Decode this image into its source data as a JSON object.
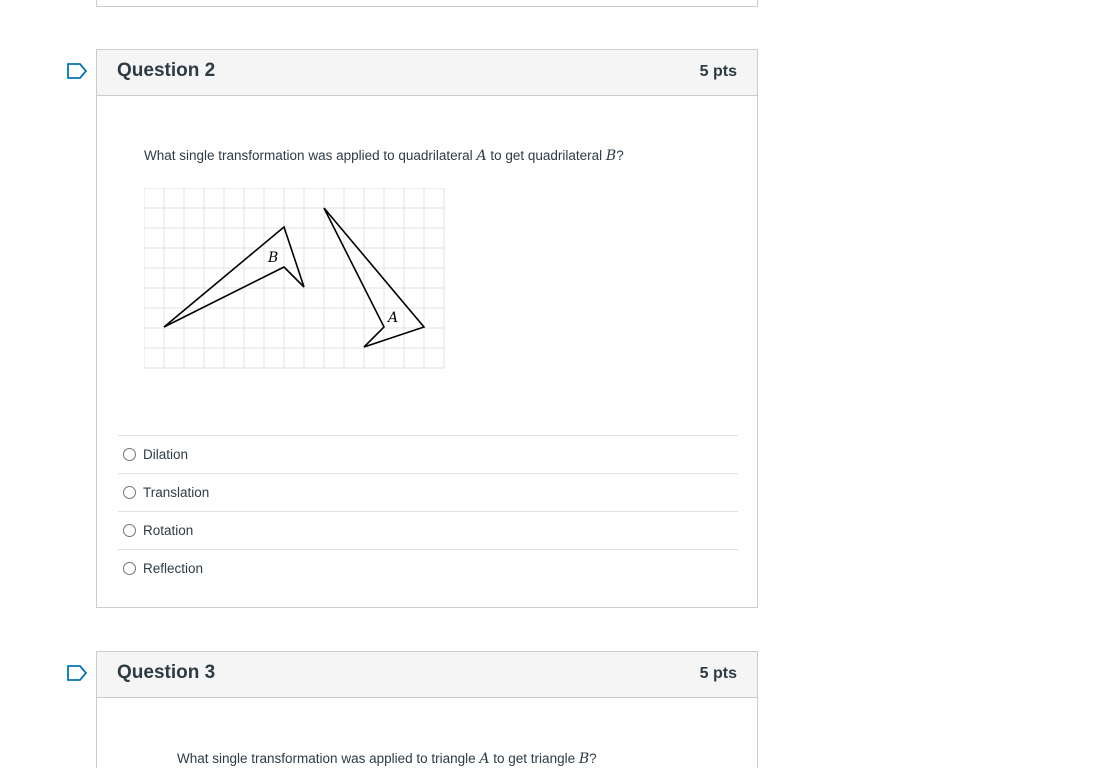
{
  "question2": {
    "title": "Question 2",
    "points": "5 pts",
    "prompt_before_a": "What single transformation was applied to quadrilateral ",
    "var_a": "A",
    "prompt_middle": " to get quadrilateral ",
    "var_b": "B",
    "prompt_end": "?",
    "figure": {
      "label_b": "B",
      "label_a": "A"
    },
    "answers": [
      {
        "label": "Dilation"
      },
      {
        "label": "Translation"
      },
      {
        "label": "Rotation"
      },
      {
        "label": "Reflection"
      }
    ]
  },
  "question3": {
    "title": "Question 3",
    "points": "5 pts",
    "prompt_before_a": "What single transformation was applied to triangle ",
    "var_a": "A",
    "prompt_middle": " to get triangle ",
    "var_b": "B",
    "prompt_end": "?"
  },
  "icons": {
    "flag": "flag-outline-icon",
    "radio": "radio-unselected-icon"
  },
  "colors": {
    "flag": "#0374b5",
    "header_bg": "#f5f5f5",
    "border": "#c7cdd1",
    "grid": "#e1e1e1"
  }
}
